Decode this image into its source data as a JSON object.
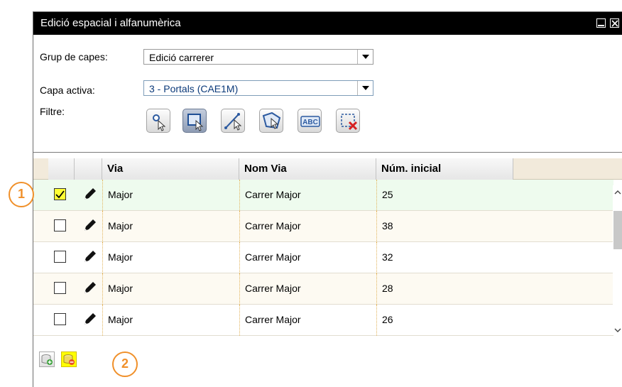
{
  "window": {
    "title": "Edició espacial i alfanumèrica"
  },
  "form": {
    "group_label": "Grup de capes:",
    "group_value": "Edició carrerer",
    "layer_label": "Capa activa:",
    "layer_value": "3 - Portals (CAE1M)",
    "filter_label": "Filtre:"
  },
  "filter_tools": [
    {
      "icon": "point-select-icon",
      "pressed": false
    },
    {
      "icon": "rectangle-select-icon",
      "pressed": true
    },
    {
      "icon": "line-select-icon",
      "pressed": false
    },
    {
      "icon": "polygon-select-icon",
      "pressed": false
    },
    {
      "icon": "text-select-icon",
      "label": "ABC",
      "pressed": false
    },
    {
      "icon": "clear-selection-icon",
      "pressed": false
    }
  ],
  "grid": {
    "columns": [
      "Via",
      "Nom Via",
      "Núm. inicial"
    ],
    "rows": [
      {
        "checked": true,
        "via": "Major",
        "nom_via": "Carrer Major",
        "num": "25"
      },
      {
        "checked": false,
        "via": "Major",
        "nom_via": "Carrer Major",
        "num": "38"
      },
      {
        "checked": false,
        "via": "Major",
        "nom_via": "Carrer Major",
        "num": "32"
      },
      {
        "checked": false,
        "via": "Major",
        "nom_via": "Carrer Major",
        "num": "28"
      },
      {
        "checked": false,
        "via": "Major",
        "nom_via": "Carrer Major",
        "num": "26"
      }
    ]
  },
  "callouts": [
    "1",
    "2"
  ],
  "colors": {
    "callout": "#f0902a",
    "highlight": "#ffff00",
    "titlebar": "#000000"
  }
}
